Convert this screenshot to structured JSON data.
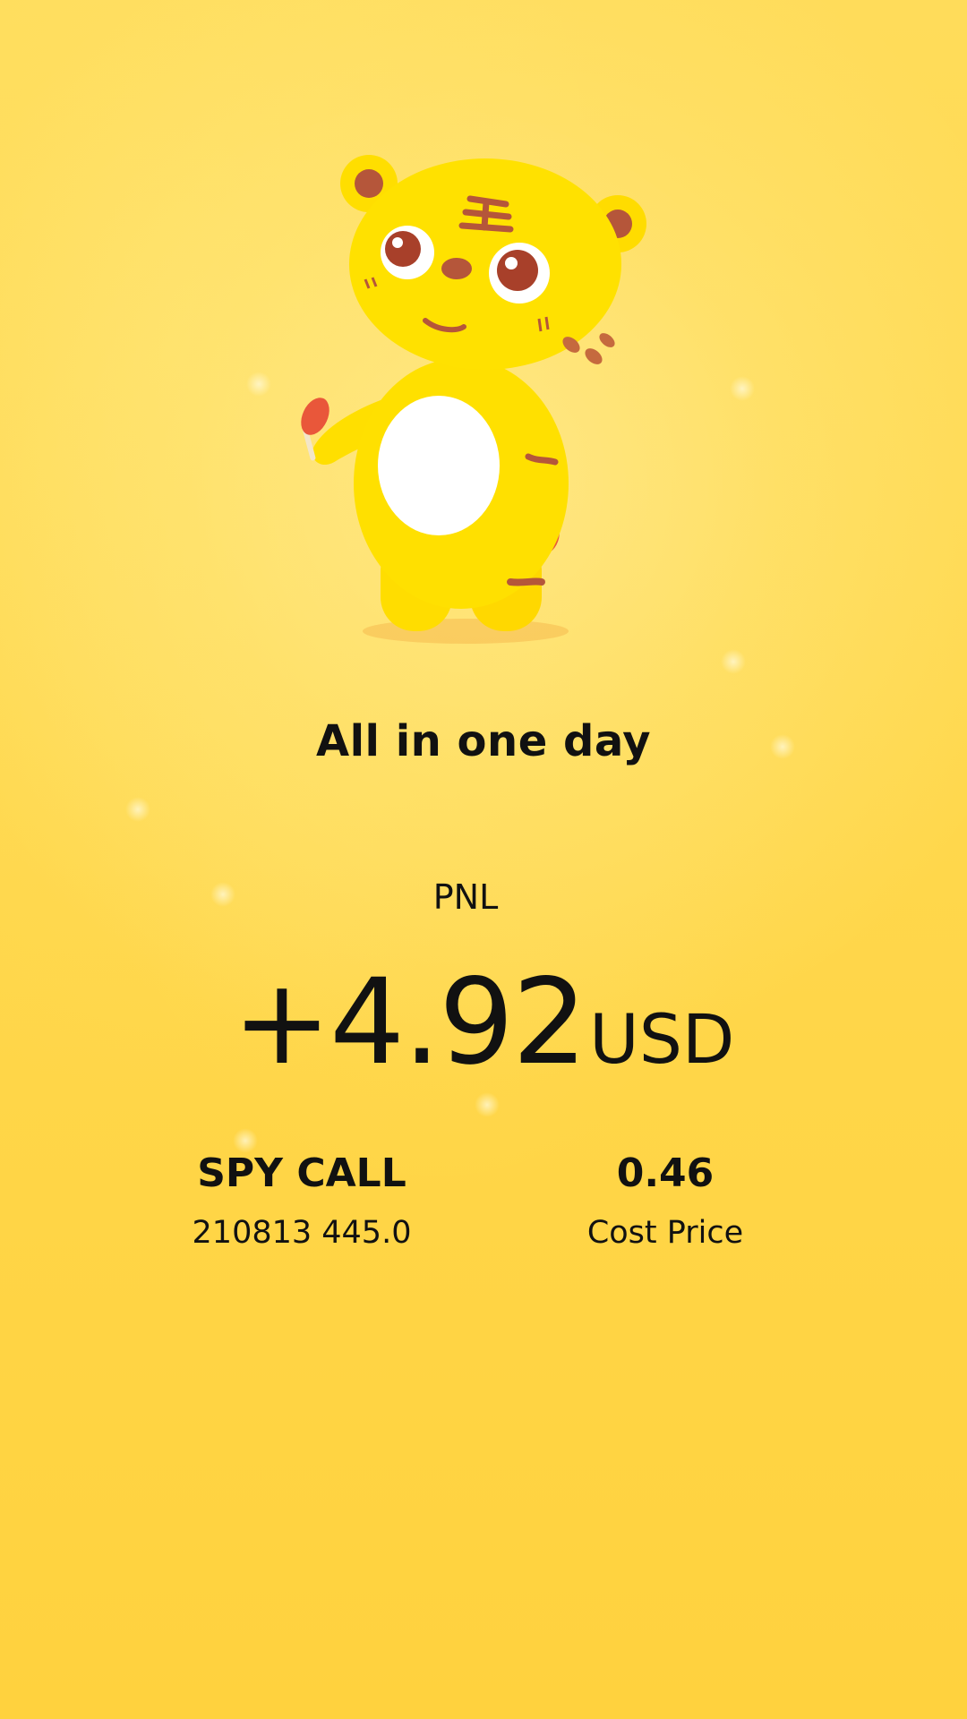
{
  "headline": "All in one day",
  "pnl": {
    "label": "PNL",
    "value": "+4.92",
    "unit": "USD"
  },
  "position": {
    "name": "SPY CALL",
    "contract": "210813 445.0"
  },
  "cost": {
    "value": "0.46",
    "label": "Cost Price"
  },
  "mascot": {
    "icon": "tiger-mascot-icon"
  },
  "colors": {
    "background": "#FFD64A",
    "text": "#111111",
    "mascot_body": "#FFE000"
  }
}
